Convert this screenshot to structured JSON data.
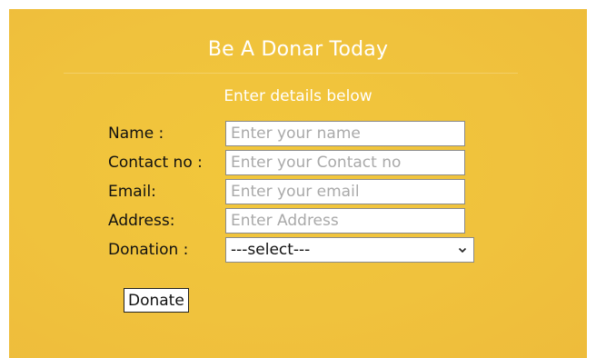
{
  "form": {
    "title": "Be A Donar Today",
    "subtitle": "Enter details below",
    "fields": [
      {
        "label": "Name :",
        "placeholder": "Enter your name"
      },
      {
        "label": "Contact no :",
        "placeholder": "Enter your Contact no"
      },
      {
        "label": "Email:",
        "placeholder": "Enter your email"
      },
      {
        "label": "Address:",
        "placeholder": "Enter Address"
      }
    ],
    "donation": {
      "label": "Donation :",
      "selected": "---select---"
    },
    "submit_label": "Donate"
  },
  "colors": {
    "panel_background": "#f0c23d",
    "heading_text": "#ffffff",
    "label_text": "#111111",
    "placeholder_text": "#a9a9a9"
  }
}
